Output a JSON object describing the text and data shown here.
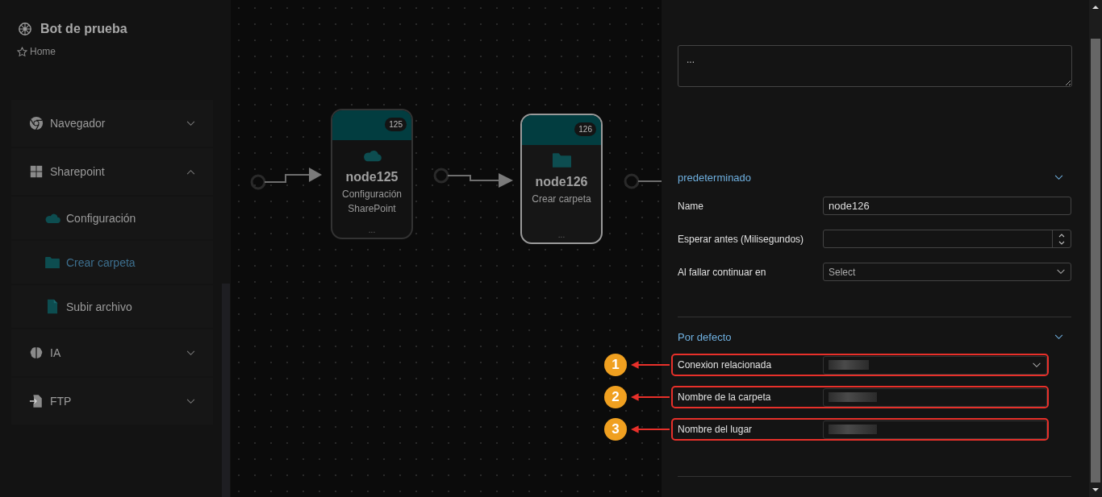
{
  "sidebar": {
    "title": "Bot de prueba",
    "breadcrumb": "Home",
    "items": [
      {
        "label": "Navegador",
        "kind": "chrome",
        "expanded": false
      },
      {
        "label": "Sharepoint",
        "kind": "windows",
        "expanded": true,
        "children": [
          {
            "label": "Configuración",
            "kind": "cloud",
            "selected": false
          },
          {
            "label": "Crear carpeta",
            "kind": "folder",
            "selected": true
          },
          {
            "label": "Subir archivo",
            "kind": "file",
            "selected": false
          }
        ]
      },
      {
        "label": "IA",
        "kind": "brain",
        "expanded": false
      },
      {
        "label": "FTP",
        "kind": "import",
        "expanded": false
      }
    ]
  },
  "canvas": {
    "nodes": [
      {
        "badge": "125",
        "title": "node125",
        "subtitle": "Configuración SharePoint",
        "kind": "cloud",
        "selected": false,
        "more": "..."
      },
      {
        "badge": "126",
        "title": "node126",
        "subtitle": "Crear carpeta",
        "kind": "folder",
        "selected": true,
        "more": "..."
      }
    ]
  },
  "panel": {
    "note": "...",
    "sections": [
      {
        "title": "predeterminado",
        "expanded": true,
        "fields": [
          {
            "label": "Name",
            "kind": "text",
            "value": "node126"
          },
          {
            "label": "Esperar antes (Milisegundos)",
            "kind": "number"
          },
          {
            "label": "Al fallar continuar en",
            "kind": "select",
            "placeholder": "Select"
          }
        ]
      },
      {
        "title": "Por defecto",
        "expanded": true,
        "fields": [
          {
            "label": "Conexion relacionada",
            "kind": "select",
            "redacted": true,
            "callout": "1"
          },
          {
            "label": "Nombre de la carpeta",
            "kind": "text",
            "redacted": true,
            "callout": "2"
          },
          {
            "label": "Nombre del lugar",
            "kind": "text",
            "redacted": true,
            "callout": "3"
          }
        ]
      }
    ]
  }
}
